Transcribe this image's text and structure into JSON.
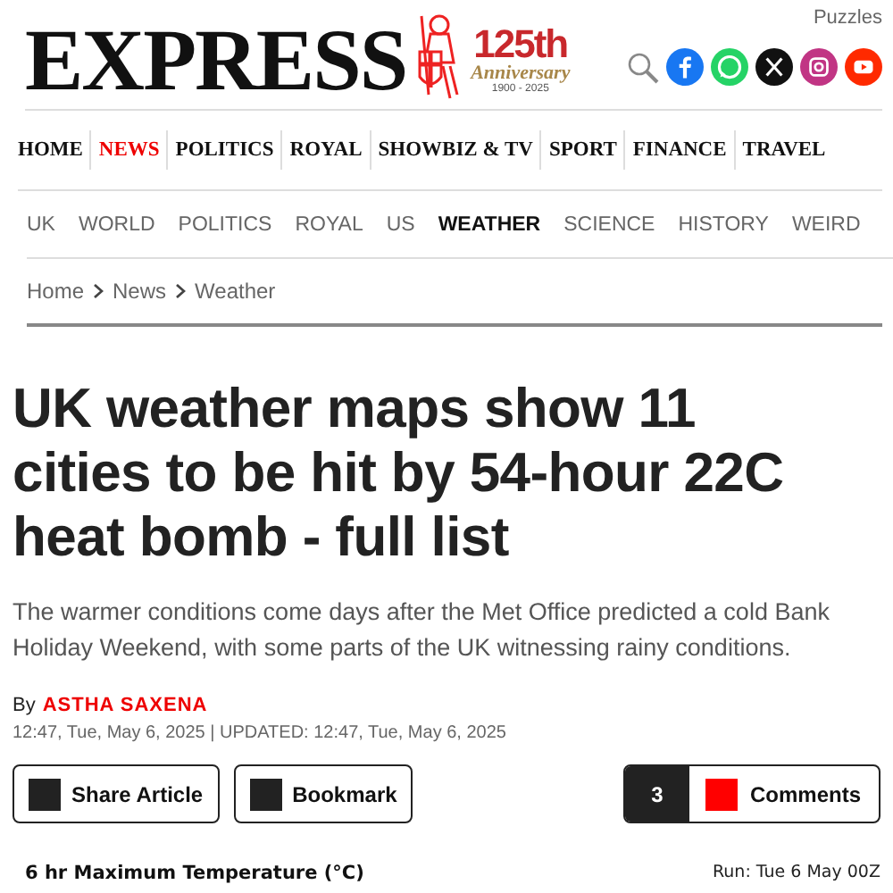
{
  "header": {
    "logo": "EXPRESS",
    "anniversary": {
      "number": "125th",
      "word": "Anniversary",
      "years": "1900 - 2025"
    },
    "puzzles_link": "Puzzles"
  },
  "main_nav": [
    {
      "label": "HOME",
      "selected": false
    },
    {
      "label": "NEWS",
      "selected": true
    },
    {
      "label": "POLITICS",
      "selected": false
    },
    {
      "label": "ROYAL",
      "selected": false
    },
    {
      "label": "SHOWBIZ & TV",
      "selected": false
    },
    {
      "label": "SPORT",
      "selected": false
    },
    {
      "label": "FINANCE",
      "selected": false
    },
    {
      "label": "TRAVEL",
      "selected": false
    }
  ],
  "sub_nav": [
    {
      "label": "UK",
      "selected": false
    },
    {
      "label": "WORLD",
      "selected": false
    },
    {
      "label": "POLITICS",
      "selected": false
    },
    {
      "label": "ROYAL",
      "selected": false
    },
    {
      "label": "US",
      "selected": false
    },
    {
      "label": "WEATHER",
      "selected": true
    },
    {
      "label": "SCIENCE",
      "selected": false
    },
    {
      "label": "HISTORY",
      "selected": false
    },
    {
      "label": "WEIRD",
      "selected": false
    }
  ],
  "breadcrumb": [
    "Home",
    "News",
    "Weather"
  ],
  "article": {
    "headline": "UK weather maps show 11 cities to be hit by 54-hour 22C heat bomb - full list",
    "summary": "The warmer conditions come days after the Met Office predicted a cold Bank Holiday Weekend, with some parts of the UK witnessing rainy conditions.",
    "byline_prefix": "By",
    "author": "ASTHA SAXENA",
    "timestamp": "12:47, Tue, May 6, 2025 | UPDATED: 12:47, Tue, May 6, 2025"
  },
  "actions": {
    "share": "Share Article",
    "bookmark": "Bookmark",
    "comment_count": "3",
    "comments": "Comments"
  },
  "map": {
    "title": "6 hr Maximum Temperature (°C)",
    "run": "Run: Tue 6 May 00Z"
  }
}
